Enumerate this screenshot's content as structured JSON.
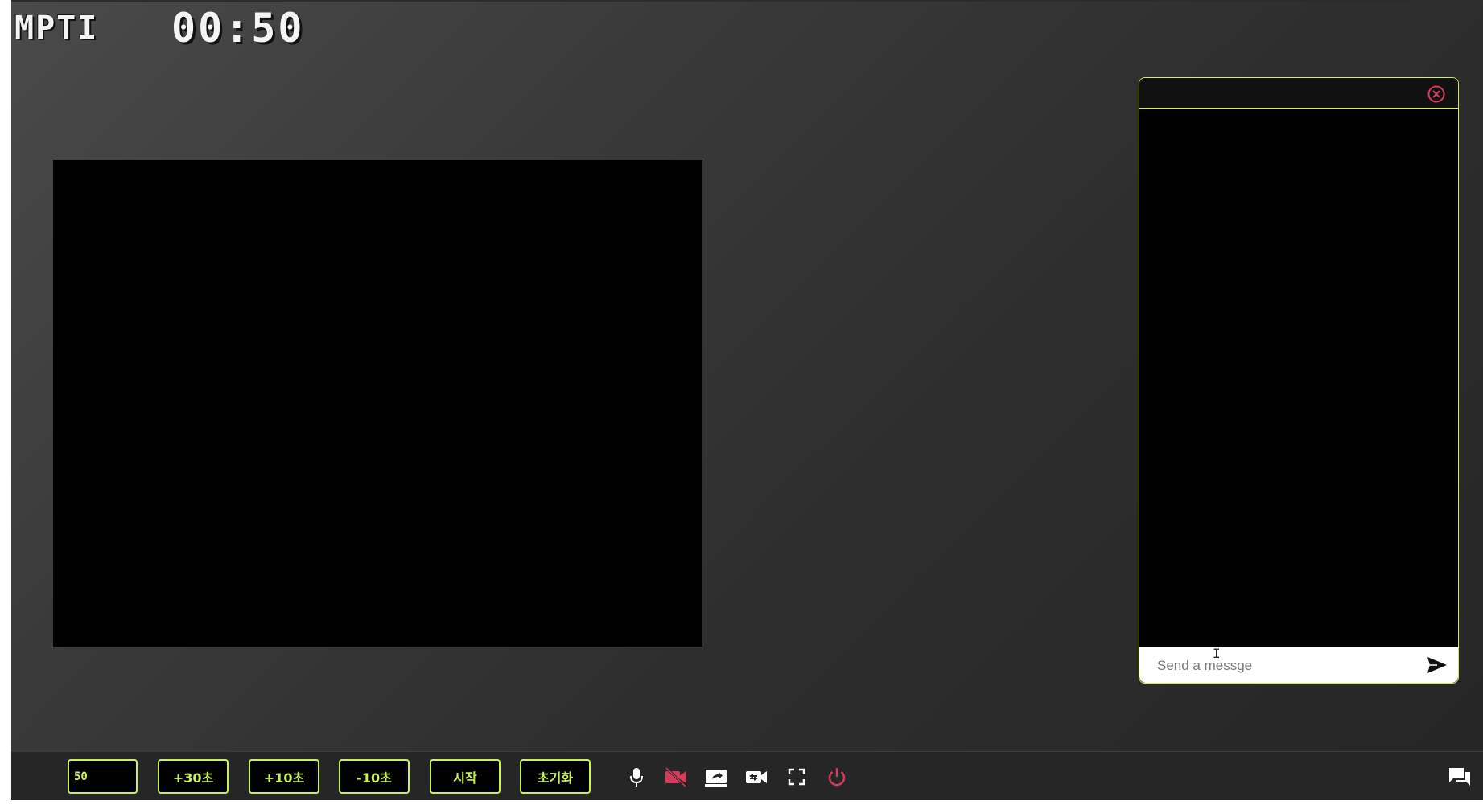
{
  "header": {
    "logo_text": "MPTI",
    "timer": "00:50"
  },
  "chat": {
    "title": "",
    "input_placeholder": "Send a messge",
    "input_value": ""
  },
  "toolbar": {
    "seconds_input_value": "50",
    "buttons": [
      {
        "label": "+30초"
      },
      {
        "label": "+10초"
      },
      {
        "label": "-10초"
      },
      {
        "label": "시작"
      },
      {
        "label": "초기화"
      }
    ],
    "icons": [
      "microphone-icon",
      "camera-off-icon",
      "screen-share-icon",
      "switch-camera-icon",
      "fullscreen-icon",
      "power-icon",
      "chat-icon"
    ]
  },
  "colors": {
    "accent": "#c8f25a",
    "danger": "#d63b5b",
    "background": "#3a3a3a",
    "video_bg": "#000000"
  }
}
